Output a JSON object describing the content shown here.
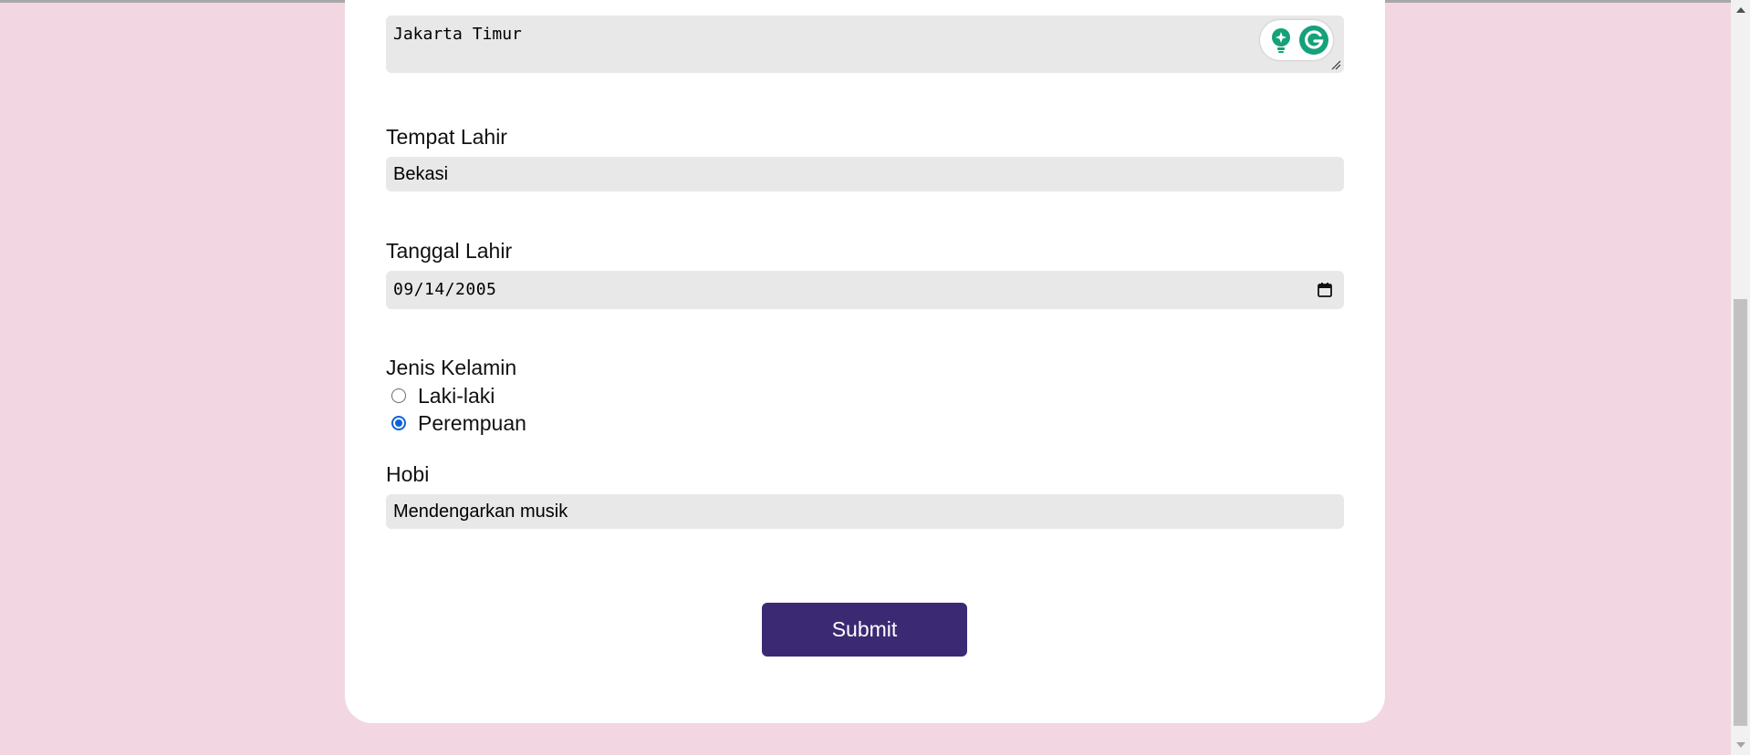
{
  "form": {
    "alamat_value": "Jakarta Timur",
    "tempat_lahir": {
      "label": "Tempat Lahir",
      "value": "Bekasi"
    },
    "tanggal_lahir": {
      "label": "Tanggal Lahir",
      "value": "09/14/2005"
    },
    "jenis_kelamin": {
      "label": "Jenis Kelamin",
      "options": [
        "Laki-laki",
        "Perempuan"
      ],
      "selected": "Perempuan"
    },
    "hobi": {
      "label": "Hobi",
      "value": "Mendengarkan musik"
    },
    "submit_label": "Submit"
  },
  "colors": {
    "page_background": "#f2d7e3",
    "card_background": "#ffffff",
    "input_background": "#e8e8e8",
    "submit_background": "#3b2a73",
    "radio_accent": "#0b63d8",
    "grammarly_green": "#15a17a"
  },
  "icons": {
    "grammarly": "grammarly-icon",
    "grammarly_suggestion": "lightbulb-icon",
    "calendar": "calendar-icon",
    "resize": "resize-grip-icon"
  }
}
